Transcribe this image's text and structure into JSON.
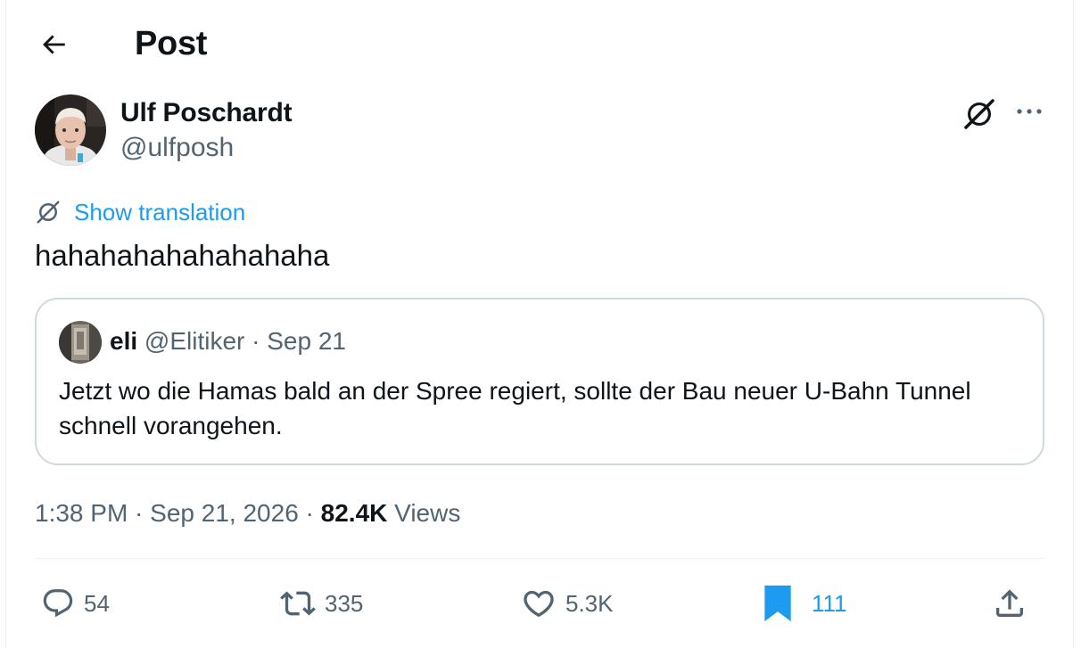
{
  "header": {
    "title": "Post",
    "back_icon": "arrow-left-icon"
  },
  "author": {
    "name": "Ulf Poschardt",
    "handle": "@ulfposh"
  },
  "translation": {
    "label": "Show translation",
    "icon": "grok-translate-icon"
  },
  "post": {
    "text": "hahahahahahahahaha"
  },
  "quote": {
    "name": "eli",
    "handle": "@Elitiker",
    "separator": " · ",
    "date": "Sep 21",
    "text": "Jetzt wo die Hamas bald an der Spree regiert, sollte der Bau neuer U-Bahn Tunnel schnell vorangehen."
  },
  "meta": {
    "time": "1:38 PM",
    "dot1": " · ",
    "date": "Sep 21, 2026",
    "dot2": " · ",
    "views_count": "82.4K",
    "views_label": " Views"
  },
  "actions": {
    "replies": "54",
    "reposts": "335",
    "likes": "5.3K",
    "bookmarks": "111"
  },
  "colors": {
    "accent": "#1d9bf0",
    "text_primary": "#0f1419",
    "text_secondary": "#536471",
    "border": "#cfd9de"
  }
}
